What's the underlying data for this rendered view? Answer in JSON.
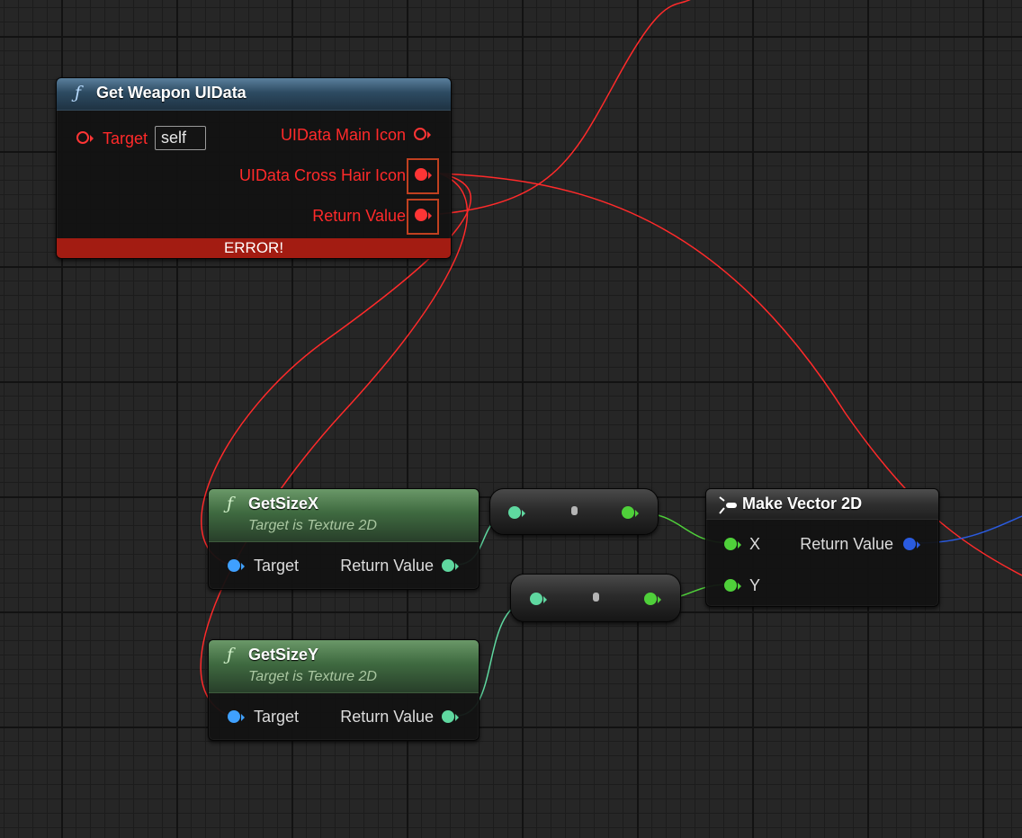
{
  "canvas": {
    "background": "#262626",
    "grid_major": "#121212",
    "grid_minor": "#1c1c1c"
  },
  "colors": {
    "error_red": "#ff3535",
    "float_teal": "#5fd8a0",
    "float_green": "#4fd03a",
    "object_blue": "#3fa0ff",
    "vector_blue": "#2a5be0",
    "error_bar": "#a31c12"
  },
  "nodes": {
    "get_weapon_uidata": {
      "icon": "function-icon",
      "title": "Get Weapon UIData",
      "target_label": "Target",
      "target_value": "self",
      "main_icon_label": "UIData Main Icon",
      "cross_hair_label": "UIData Cross Hair Icon",
      "return_label": "Return Value",
      "error_text": "ERROR!"
    },
    "get_size_x": {
      "icon": "function-icon",
      "title": "GetSizeX",
      "subtitle": "Target is Texture 2D",
      "target_label": "Target",
      "return_label": "Return Value"
    },
    "get_size_y": {
      "icon": "function-icon",
      "title": "GetSizeY",
      "subtitle": "Target is Texture 2D",
      "target_label": "Target",
      "return_label": "Return Value"
    },
    "make_vector_2d": {
      "icon": "make-struct-icon",
      "title": "Make Vector 2D",
      "x_label": "X",
      "y_label": "Y",
      "return_label": "Return Value"
    }
  }
}
